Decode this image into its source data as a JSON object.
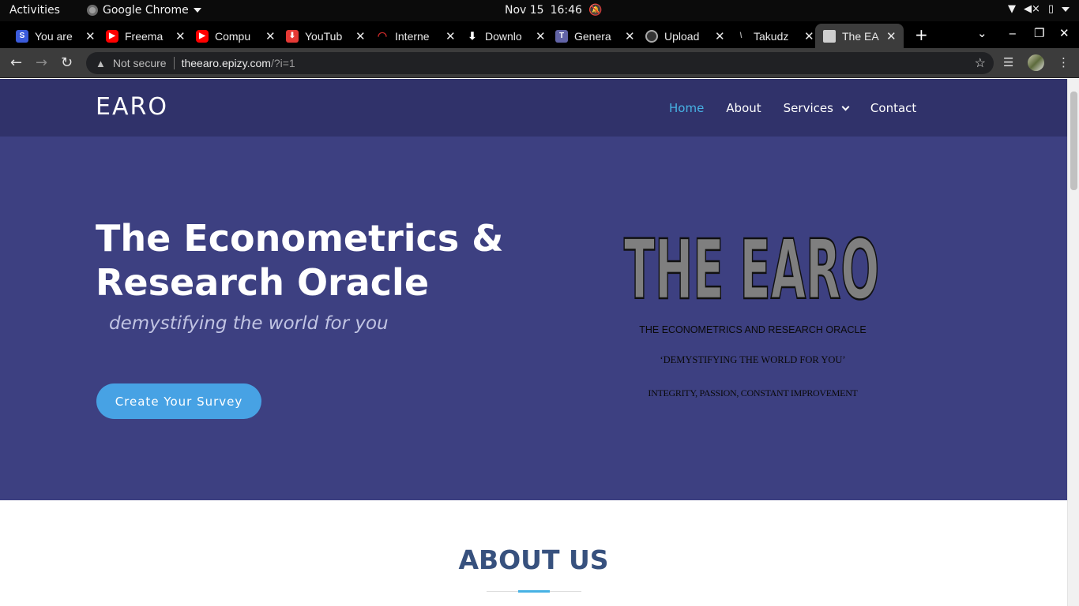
{
  "system": {
    "activities": "Activities",
    "app_name": "Google Chrome",
    "date": "Nov 15",
    "time": "16:46"
  },
  "tabs": [
    {
      "title": "You are",
      "icon": "s-icon",
      "color": "#3b5bdb"
    },
    {
      "title": "Freema",
      "icon": "youtube-icon",
      "color": "#ff0000"
    },
    {
      "title": "Compu",
      "icon": "youtube-icon",
      "color": "#ff0000"
    },
    {
      "title": "YouTub",
      "icon": "download-red-icon",
      "color": "#e53935"
    },
    {
      "title": "Interne",
      "icon": "speedometer-icon",
      "color": "#c62828"
    },
    {
      "title": "Downlo",
      "icon": "download-icon",
      "color": "#ffffff"
    },
    {
      "title": "Genera",
      "icon": "teams-icon",
      "color": "#6264a7"
    },
    {
      "title": "Upload",
      "icon": "github-icon",
      "color": "#888888"
    },
    {
      "title": "Takudz",
      "icon": "page-icon",
      "color": "#888888"
    },
    {
      "title": "The EA",
      "icon": "page-icon",
      "color": "#cfcfcf"
    }
  ],
  "address": {
    "security": "Not secure",
    "host": "theearo.epizy.com",
    "path": "/?i=1"
  },
  "site": {
    "logo": "EARO",
    "nav": {
      "home": "Home",
      "about": "About",
      "services": "Services",
      "contact": "Contact"
    },
    "hero": {
      "title": "The Econometrics & Research Oracle",
      "tagline": "demystifying the world for you",
      "cta": "Create Your Survey"
    },
    "hero_image": {
      "logo_text": "THE EARO",
      "line1": "THE ECONOMETRICS AND RESEARCH ORACLE",
      "line2": "‘DEMYSTIFYING THE WORLD FOR YOU’",
      "line3": "INTEGRITY, PASSION, CONSTANT IMPROVEMENT"
    },
    "about": {
      "title": "ABOUT US"
    }
  },
  "colors": {
    "header_bg": "#30326a",
    "hero_bg": "#3d4081",
    "accent": "#47b2e4",
    "cta_bg": "#47a2e4",
    "section_title": "#37517e"
  }
}
